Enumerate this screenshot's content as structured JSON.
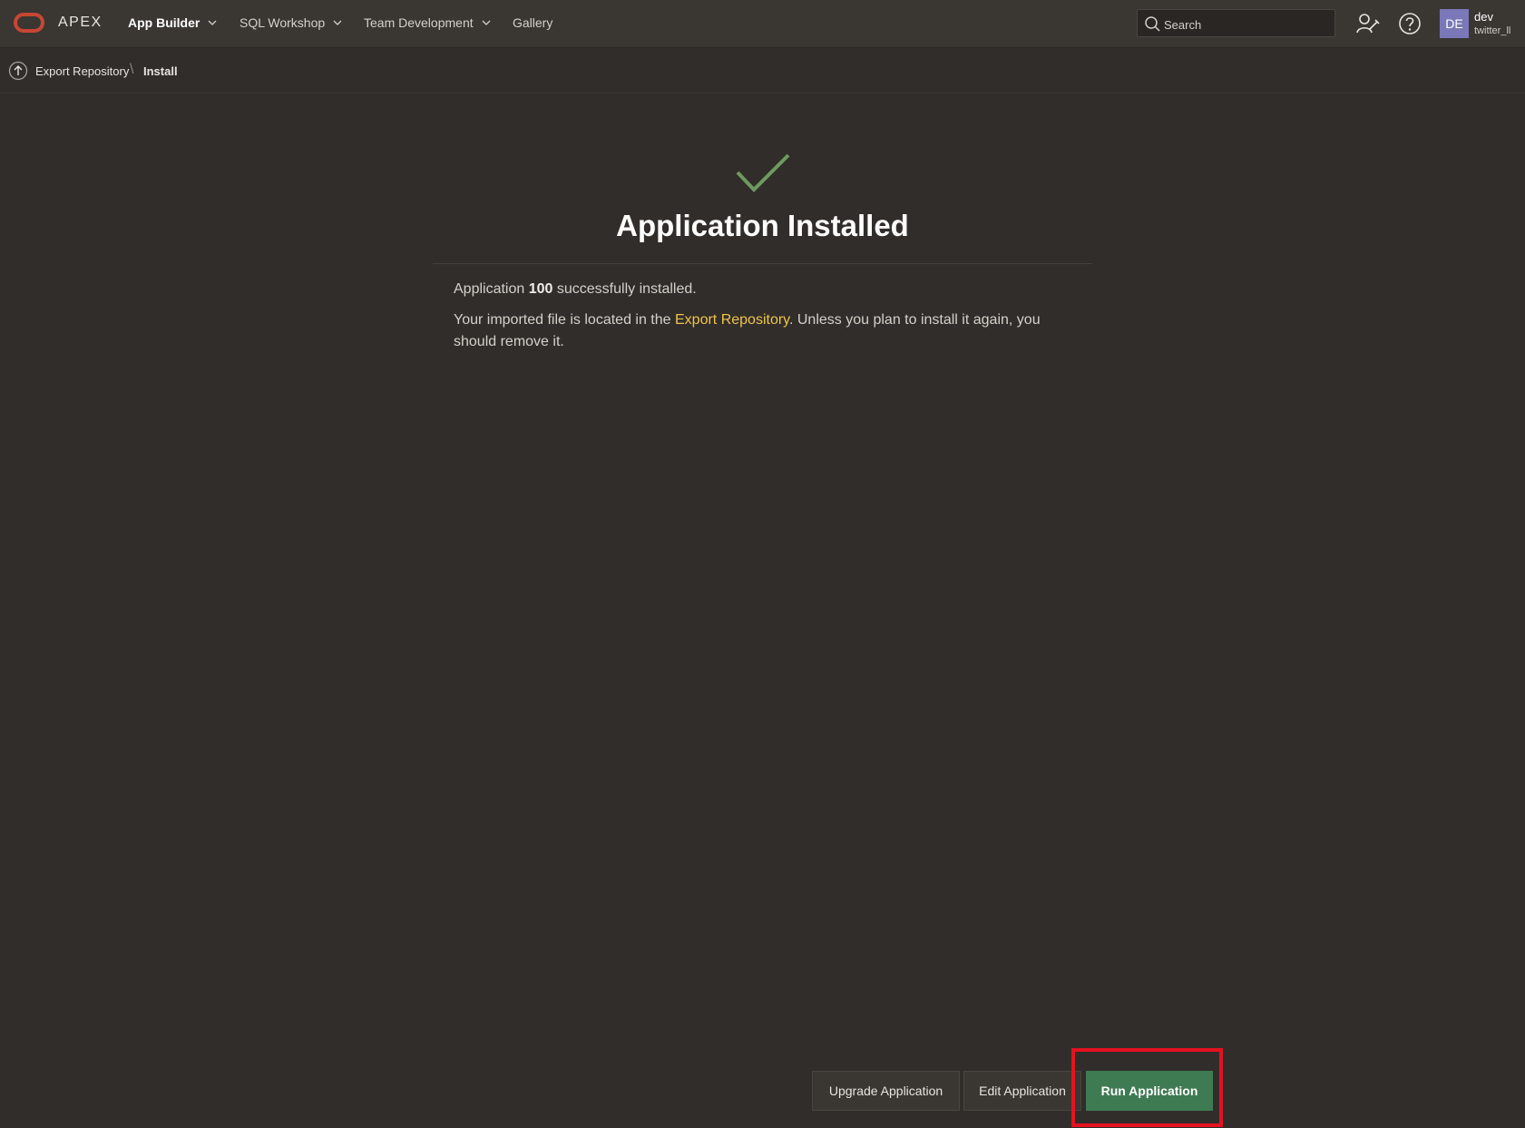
{
  "header": {
    "brand": "APEX",
    "nav": [
      {
        "label": "App Builder",
        "has_menu": true,
        "active": true
      },
      {
        "label": "SQL Workshop",
        "has_menu": true,
        "active": false
      },
      {
        "label": "Team Development",
        "has_menu": true,
        "active": false
      },
      {
        "label": "Gallery",
        "has_menu": false,
        "active": false
      }
    ],
    "search_placeholder": "Search",
    "icons": [
      "administration-icon",
      "help-icon"
    ],
    "user": {
      "initials": "DE",
      "name": "dev",
      "workspace": "twitter_ll"
    }
  },
  "breadcrumb": {
    "parent": "Export Repository",
    "current": "Install"
  },
  "main": {
    "title": "Application Installed",
    "success_prefix": "Application ",
    "app_id": "100",
    "success_suffix": " successfully installed.",
    "repo_prefix": "Your imported file is located in the ",
    "repo_link": "Export Repository",
    "repo_suffix": ". Unless you plan to install it again, you should remove it."
  },
  "actions": {
    "upgrade": "Upgrade Application",
    "edit": "Edit Application",
    "run": "Run Application"
  },
  "colors": {
    "accent_green": "#3f7b52",
    "link_yellow": "#f0c44a",
    "highlight_red": "#e5121f",
    "oracle_red": "#c74634"
  }
}
